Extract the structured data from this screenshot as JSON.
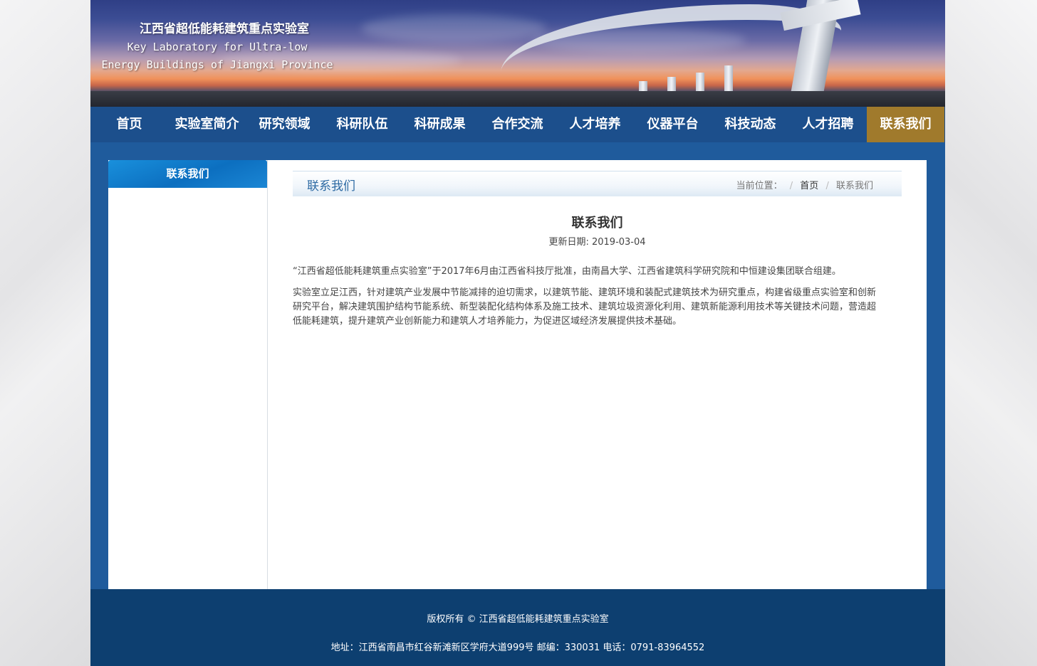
{
  "banner": {
    "title_cn": "江西省超低能耗建筑重点实验室",
    "title_en_line1": "Key Laboratory for Ultra-low",
    "title_en_line2": "Energy Buildings of Jiangxi Province"
  },
  "nav": {
    "items": [
      {
        "label": "首页"
      },
      {
        "label": "实验室简介"
      },
      {
        "label": "研究领域"
      },
      {
        "label": "科研队伍"
      },
      {
        "label": "科研成果"
      },
      {
        "label": "合作交流"
      },
      {
        "label": "人才培养"
      },
      {
        "label": "仪器平台"
      },
      {
        "label": "科技动态"
      },
      {
        "label": "人才招聘"
      },
      {
        "label": "联系我们"
      }
    ],
    "active_index": 10
  },
  "sidebar": {
    "heading": "联系我们"
  },
  "breadcrumb": {
    "section_title": "联系我们",
    "prefix": "当前位置：",
    "separator": "/",
    "home": "首页",
    "current": "联系我们"
  },
  "article": {
    "title": "联系我们",
    "date": "更新日期: 2019-03-04",
    "paragraphs": [
      "“江西省超低能耗建筑重点实验室”于2017年6月由江西省科技厅批准，由南昌大学、江西省建筑科学研究院和中恒建设集团联合组建。",
      "实验室立足江西，针对建筑产业发展中节能减排的迫切需求，以建筑节能、建筑环境和装配式建筑技术为研究重点，构建省级重点实验室和创新研究平台，解决建筑围护结构节能系统、新型装配化结构体系及施工技术、建筑垃圾资源化利用、建筑新能源利用技术等关键技术问题，营造超低能耗建筑，提升建筑产业创新能力和建筑人才培养能力，为促进区域经济发展提供技术基础。"
    ]
  },
  "footer": {
    "copyright": "版权所有 © 江西省超低能耗建筑重点实验室",
    "address": "地址：江西省南昌市红谷新滩新区学府大道999号 邮编：330031 电话：0791-83964552"
  },
  "colors": {
    "nav_bg": "#1c4f8c",
    "nav_active": "#a07a2c",
    "main_bg": "#1f5b9c",
    "footer_bg": "#0d3f70",
    "crumb_title": "#2d6aa3"
  }
}
